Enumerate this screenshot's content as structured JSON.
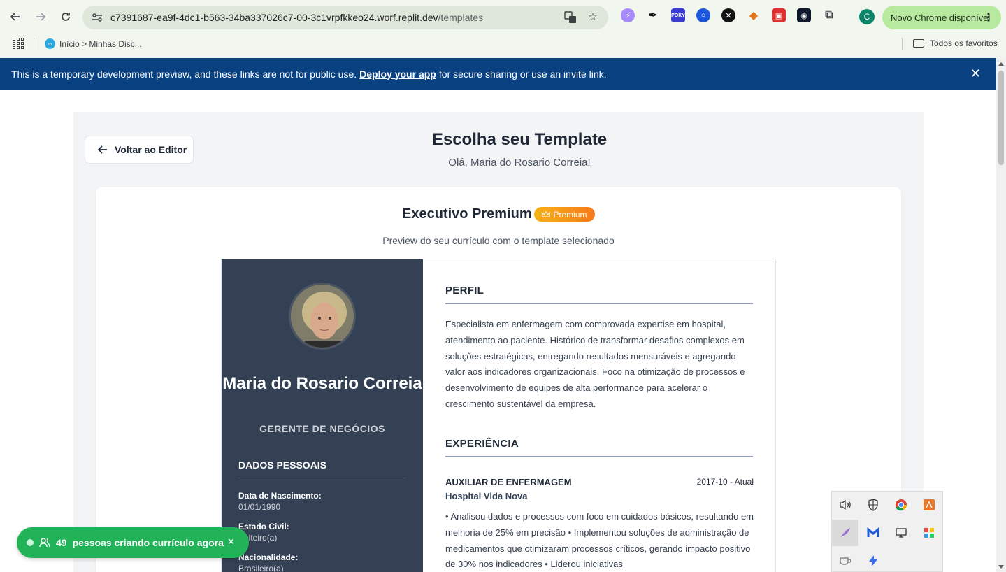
{
  "browser": {
    "url_host": "c7391687-ea9f-4dc1-b563-34ba337026c7-00-3c1vrpfkkeo24.worf.replit.dev",
    "url_path": "/templates",
    "profile_initial": "C",
    "update_label": "Novo Chrome disponível",
    "bookmark_label": "Início > Minhas Disc...",
    "bookmarks_folder": "Todos os favoritos"
  },
  "banner": {
    "text_before": "This is a temporary development preview, and these links are not for public use.",
    "link": "Deploy your app",
    "text_after": "for secure sharing or use an invite link.",
    "bg_color": "#0a4181"
  },
  "page": {
    "back_label": "Voltar ao Editor",
    "title": "Escolha seu Template",
    "greeting": "Olá, Maria do Rosario Correia!"
  },
  "template": {
    "name": "Executivo Premium",
    "badge": "Premium",
    "preview_note": "Preview do seu currículo com o template selecionado"
  },
  "resume": {
    "name": "Maria do Rosario Correia",
    "role": "GERENTE DE NEGÓCIOS",
    "personal_heading": "DADOS PESSOAIS",
    "fields": [
      {
        "label": "Data de Nascimento:",
        "value": "01/01/1990"
      },
      {
        "label": "Estado Civil:",
        "value": "Solteiro(a)"
      },
      {
        "label": "Nacionalidade:",
        "value": "Brasileiro(a)"
      }
    ],
    "profile_heading": "PERFIL",
    "profile_text": "Especialista em enfermagem com comprovada expertise em hospital, atendimento ao paciente. Histórico de transformar desafios complexos em soluções estratégicas, entregando resultados mensuráveis e agregando valor aos indicadores organizacionais. Foco na otimização de processos e desenvolvimento de equipes de alta performance para acelerar o crescimento sustentável da empresa.",
    "experience_heading": "EXPERIÊNCIA",
    "job": {
      "title": "AUXILIAR DE ENFERMAGEM",
      "date": "2017-10 - Atual",
      "company": "Hospital Vida Nova",
      "description": "• Analisou dados e processos com foco em cuidados básicos, resultando em melhoria de 25% em precisão • Implementou soluções de administração de medicamentos que otimizaram processos críticos, gerando impacto positivo de 30% nos indicadores • Liderou iniciativas"
    }
  },
  "toast": {
    "count": "49",
    "text": "pessoas criando currículo agora",
    "color": "#22b257"
  }
}
